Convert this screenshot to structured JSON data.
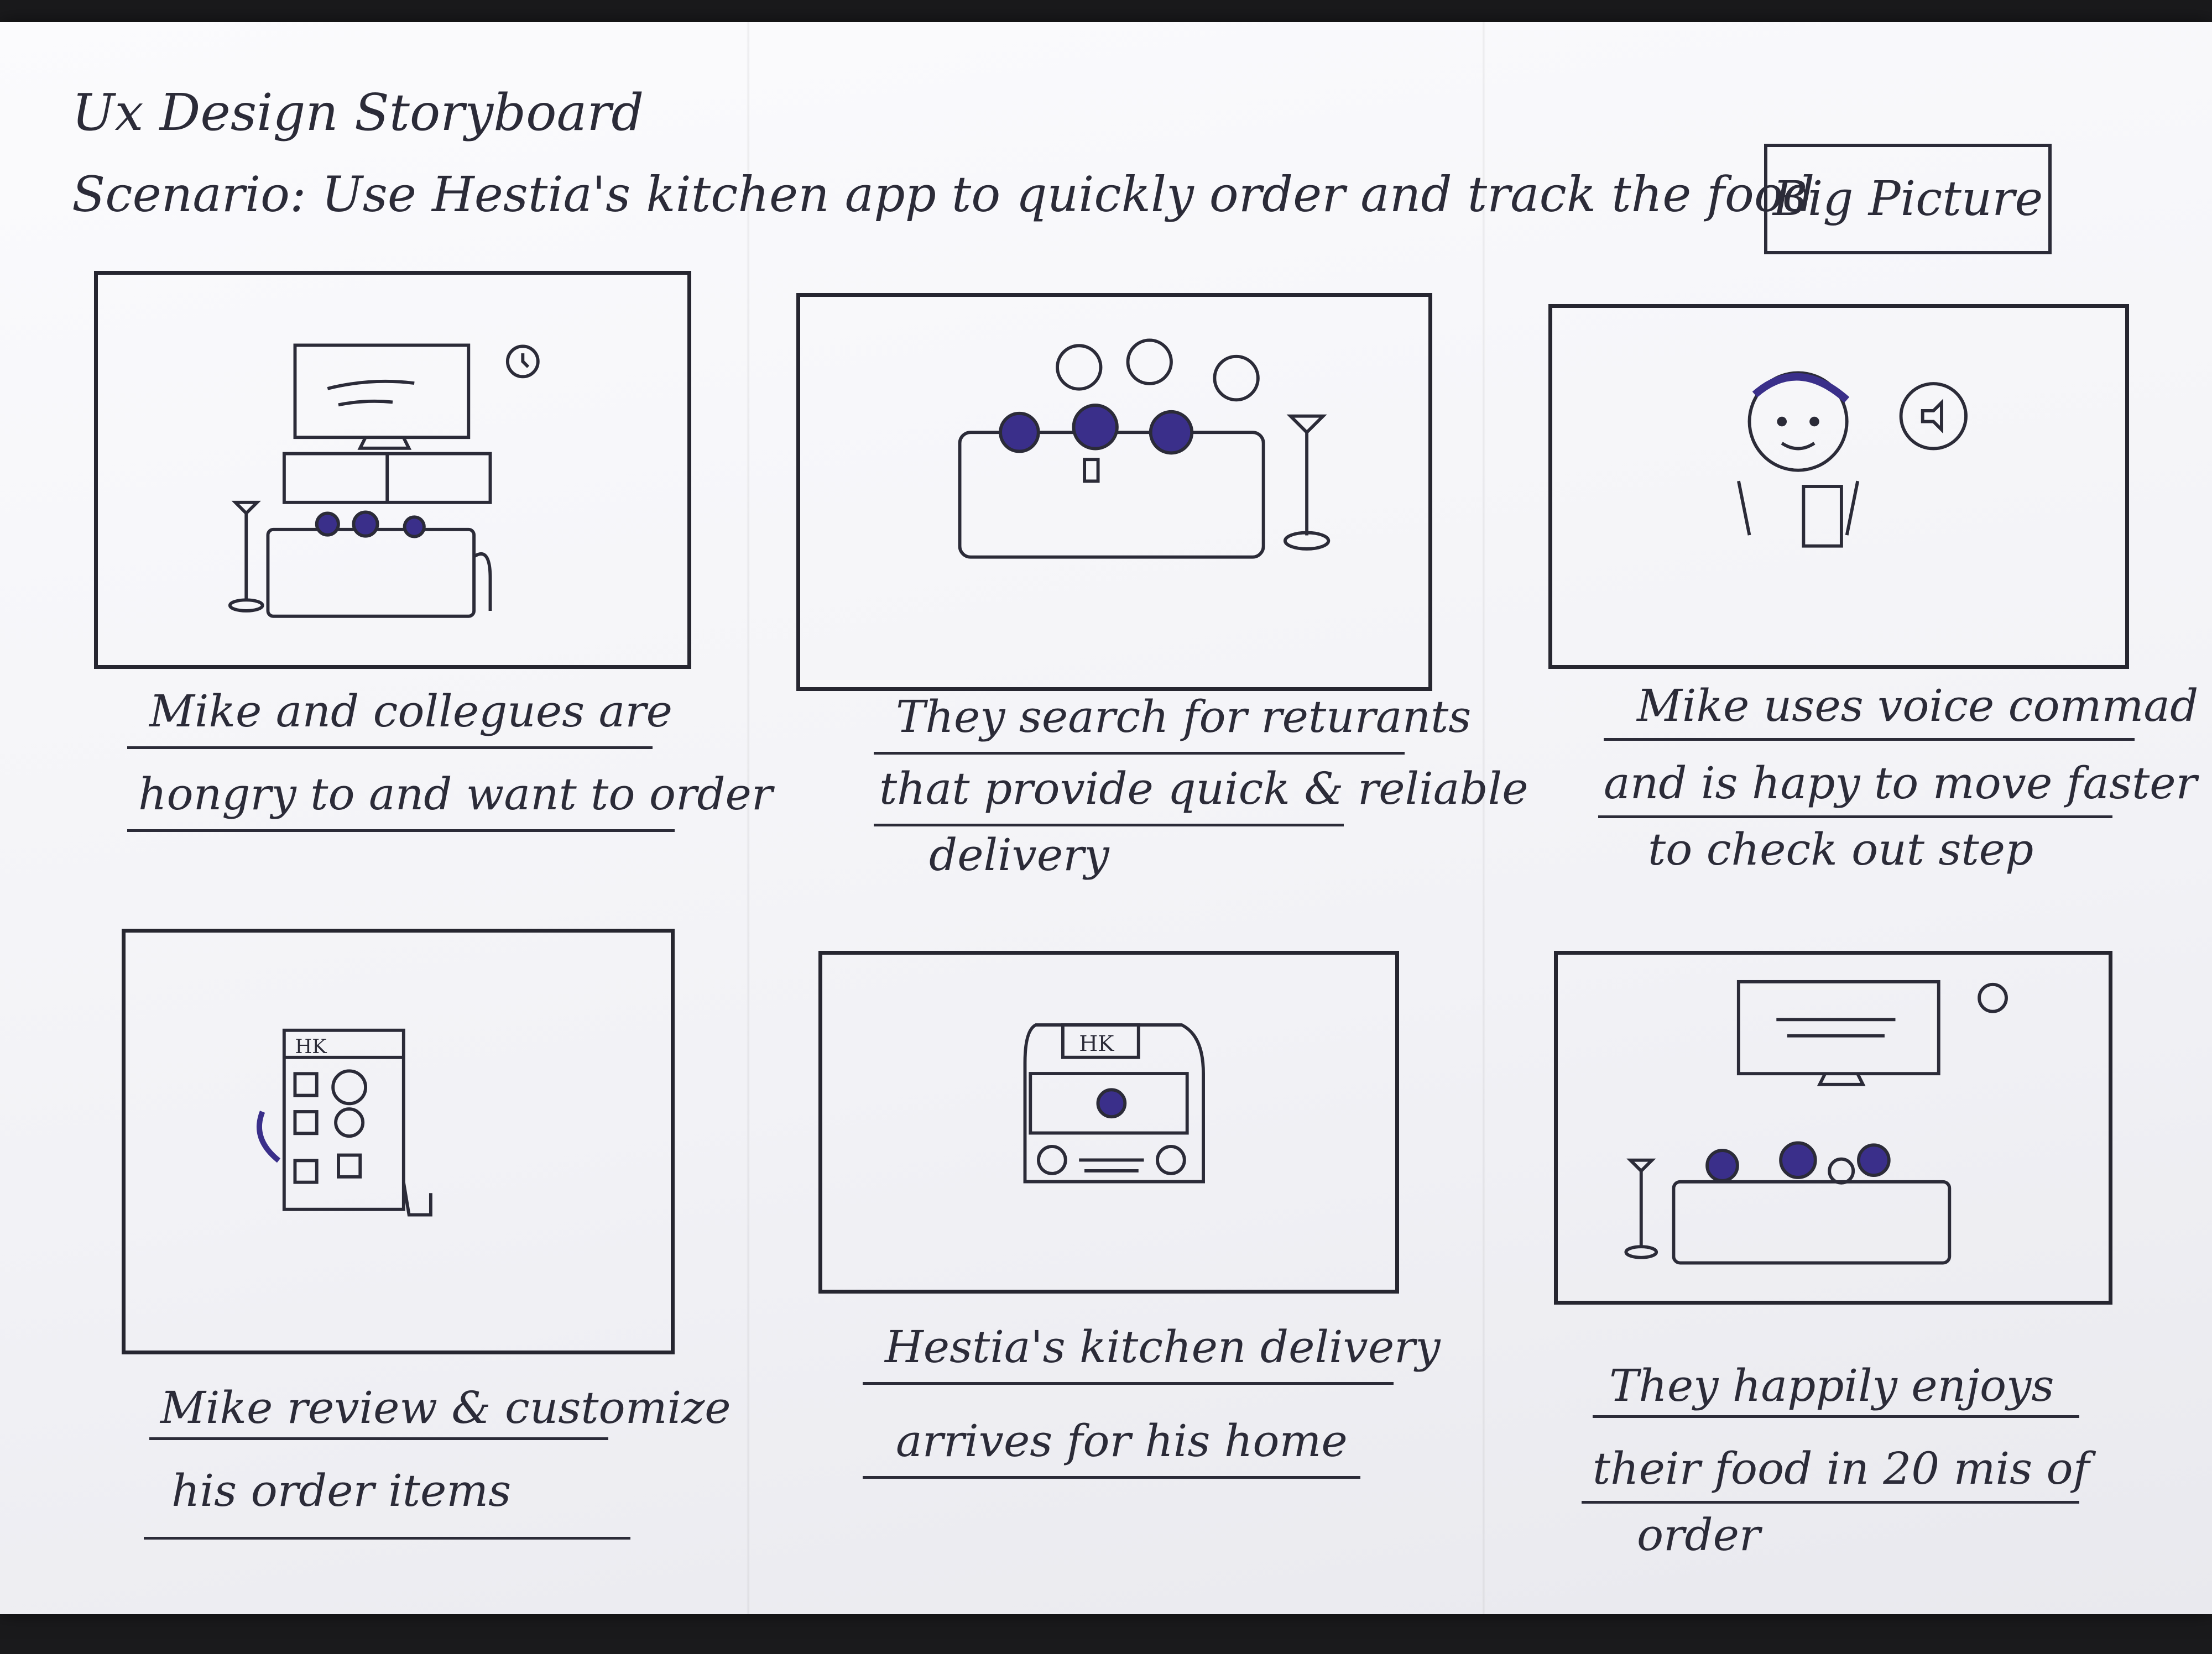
{
  "header": {
    "title": "Ux Design Storyboard",
    "scenario": "Scenario: Use Hestia's kitchen app to quickly order and track the food",
    "big_picture": "Big Picture"
  },
  "panels": [
    {
      "caption": [
        "Mike and collegues are",
        "hongry to and want to order"
      ]
    },
    {
      "caption": [
        "They search for returants",
        "that provide quick & reliable",
        "delivery"
      ]
    },
    {
      "caption": [
        "Mike uses voice commad",
        "and is hapy to move faster",
        "to check out step"
      ]
    },
    {
      "caption": [
        "Mike review & customize",
        "his order items"
      ]
    },
    {
      "caption": [
        "Hestia's kitchen delivery",
        "arrives for his home"
      ]
    },
    {
      "caption": [
        "They happily enjoys",
        "their food in 20 mis of",
        "order"
      ]
    }
  ],
  "sketch": {
    "ink_color": "#2b2b38",
    "pen_color": "#3a2f8a",
    "truck_sign": "HK",
    "app_sign": "HK"
  }
}
